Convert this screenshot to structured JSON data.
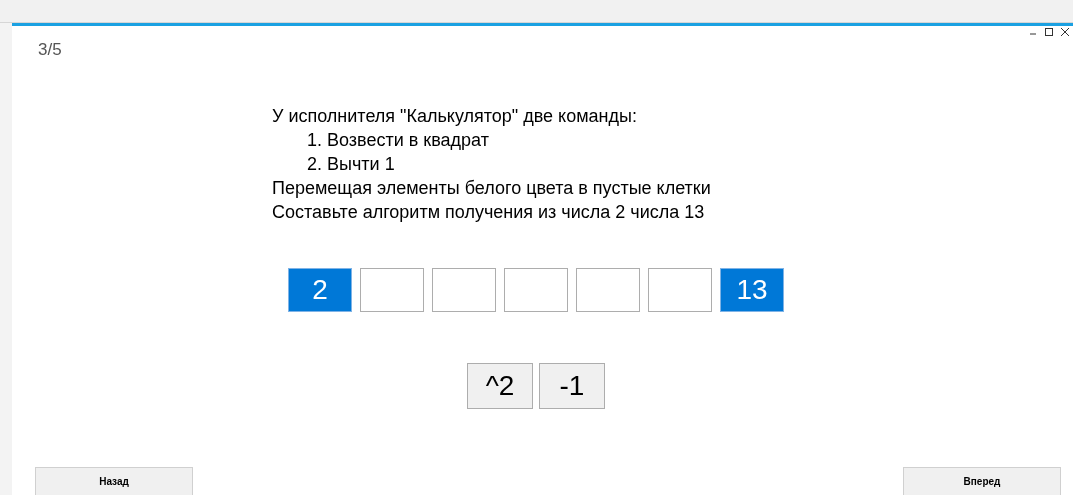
{
  "counter": "3/5",
  "task": [
    {
      "kind": "plain",
      "text": "У исполнителя \"Калькулятор\" две команды:"
    },
    {
      "kind": "item",
      "text": "1. Возвести в квадрат"
    },
    {
      "kind": "item",
      "text": "2. Вычти 1"
    },
    {
      "kind": "plain",
      "text": "Перемещая элементы белого цвета в пустые клетки"
    },
    {
      "kind": "plain",
      "text": "Составьте алгоритм получения из числа 2 числа 13"
    }
  ],
  "cells": [
    {
      "filled": true,
      "value": "2"
    },
    {
      "filled": false
    },
    {
      "filled": false
    },
    {
      "filled": false
    },
    {
      "filled": false
    },
    {
      "filled": false
    },
    {
      "filled": true,
      "value": "13"
    }
  ],
  "commands": [
    "^2",
    "-1"
  ],
  "nav": {
    "back": "Назад",
    "next": "Вперед"
  }
}
